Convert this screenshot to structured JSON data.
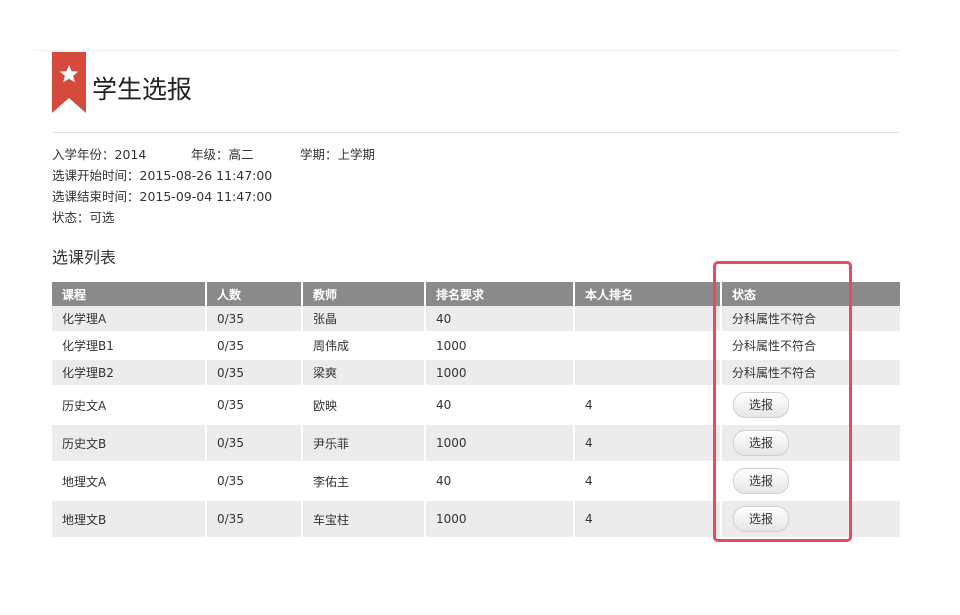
{
  "page": {
    "title": "学生选报",
    "accent": "#d54a3d"
  },
  "info": {
    "enroll_year": "入学年份：2014",
    "grade": "年级：高二",
    "term": "学期：上学期",
    "start_time": "选课开始时间：2015-08-26 11:47:00",
    "end_time": "选课结束时间：2015-09-04 11:47:00",
    "status": "状态：可选"
  },
  "course_list": {
    "title": "选课列表",
    "columns": [
      "课程",
      "人数",
      "教师",
      "排名要求",
      "本人排名",
      "状态"
    ],
    "rows": [
      {
        "course": "化学理A",
        "count": "0/35",
        "teacher": "张晶",
        "rank_req": "40",
        "my_rank": "",
        "status": "分科属性不符合"
      },
      {
        "course": "化学理B1",
        "count": "0/35",
        "teacher": "周伟成",
        "rank_req": "1000",
        "my_rank": "",
        "status": "分科属性不符合"
      },
      {
        "course": "化学理B2",
        "count": "0/35",
        "teacher": "梁爽",
        "rank_req": "1000",
        "my_rank": "",
        "status": "分科属性不符合"
      },
      {
        "course": "历史文A",
        "count": "0/35",
        "teacher": "欧映",
        "rank_req": "40",
        "my_rank": "4",
        "status": "选报"
      },
      {
        "course": "历史文B",
        "count": "0/35",
        "teacher": "尹乐菲",
        "rank_req": "1000",
        "my_rank": "4",
        "status": "选报"
      },
      {
        "course": "地理文A",
        "count": "0/35",
        "teacher": "李佑主",
        "rank_req": "40",
        "my_rank": "4",
        "status": "选报"
      },
      {
        "course": "地理文B",
        "count": "0/35",
        "teacher": "车宝柱",
        "rank_req": "1000",
        "my_rank": "4",
        "status": "选报"
      }
    ]
  },
  "highlight_color": "#ea4a5a"
}
